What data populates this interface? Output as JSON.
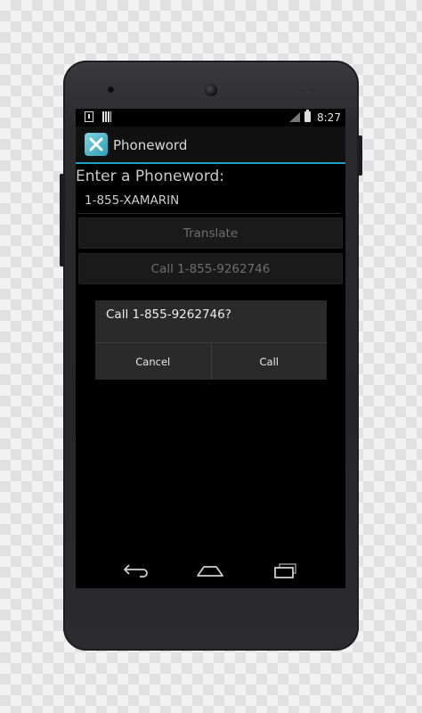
{
  "status_bar": {
    "time": "8:27",
    "icons": [
      "download-icon",
      "sd-card-icon",
      "signal-icon",
      "battery-icon"
    ]
  },
  "action_bar": {
    "title": "Phoneword",
    "icon": "xamarin-app-icon",
    "accent_color": "#1aa0c4"
  },
  "form": {
    "prompt_label": "Enter a Phoneword:",
    "phone_input_value": "1-855-XAMARIN",
    "translate_button_label": "Translate",
    "call_button_label": "Call 1-855-9262746"
  },
  "dialog": {
    "message": "Call 1-855-9262746?",
    "cancel_label": "Cancel",
    "call_label": "Call"
  },
  "nav_bar": {
    "icons": [
      "back-icon",
      "home-icon",
      "recent-apps-icon"
    ]
  }
}
